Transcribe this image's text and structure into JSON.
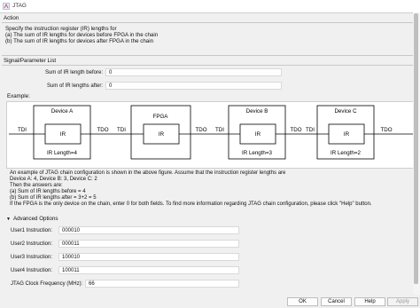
{
  "window": {
    "title": "JTAG"
  },
  "action": {
    "header": "Action",
    "lines": [
      "Specify the instruction register (IR) lengths for",
      "(a) The sum of IR lengths for devices before FPGA in the chain",
      "(b) The sum of IR lengths for devices after FPGA in the chain"
    ]
  },
  "params": {
    "header": "Signal/Parameter List",
    "ir_before_label": "Sum of IR length before:",
    "ir_before_value": "0",
    "ir_after_label": "Sum of IR lengths after:",
    "ir_after_value": "0"
  },
  "example": {
    "header": "Example:",
    "diagram": {
      "device_a": "Device A",
      "fpga": "FPGA",
      "device_b": "Device B",
      "device_c": "Device C",
      "ir": "IR",
      "tdi": "TDI",
      "tdo": "TDO",
      "ir_len_a": "IR Length=4",
      "ir_len_b": "IR Length=3",
      "ir_len_c": "IR Length=2"
    },
    "lines": [
      "An example of JTAG chain configuration is shown in the above figure. Assume that the instruction register lengths are",
      "Device A: 4, Device B: 3, Device C: 2",
      "Then the answers are:",
      "(a) Sum of IR lengths before = 4",
      "(b) Sum of IR lengths after = 3+2 = 5",
      "If the FPGA is the only device on the chain, enter 0 for both fields. To find more information regarding JTAG chain configuration, please click \"Help\" button."
    ]
  },
  "advanced": {
    "header": "Advanced Options",
    "user1_label": "User1 Instruction:",
    "user1_value": "000010",
    "user2_label": "User2 Instruction:",
    "user2_value": "000011",
    "user3_label": "User3 Instruction:",
    "user3_value": "100010",
    "user4_label": "User4 Instruction:",
    "user4_value": "100011",
    "clock_label": "JTAG Clock Frequency (MHz):",
    "clock_value": "66"
  },
  "buttons": {
    "ok": "OK",
    "cancel": "Cancel",
    "help": "Help",
    "apply": "Apply"
  }
}
